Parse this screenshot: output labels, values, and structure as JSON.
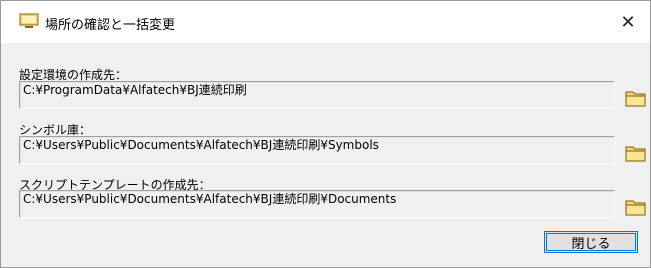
{
  "window": {
    "title": "場所の確認と一括変更",
    "close_glyph": "✕"
  },
  "fields": [
    {
      "label": "設定環境の作成先：",
      "value": "C:¥ProgramData¥Alfatech¥BJ連続印刷"
    },
    {
      "label": "シンボル庫：",
      "value": "C:¥Users¥Public¥Documents¥Alfatech¥BJ連続印刷¥Symbols"
    },
    {
      "label": "スクリプトテンプレートの作成先：",
      "value": "C:¥Users¥Public¥Documents¥Alfatech¥BJ連続印刷¥Documents"
    }
  ],
  "buttons": {
    "close_label": "閉じる"
  },
  "icons": {
    "title": "monitor-icon",
    "browse": "folder-icon"
  }
}
